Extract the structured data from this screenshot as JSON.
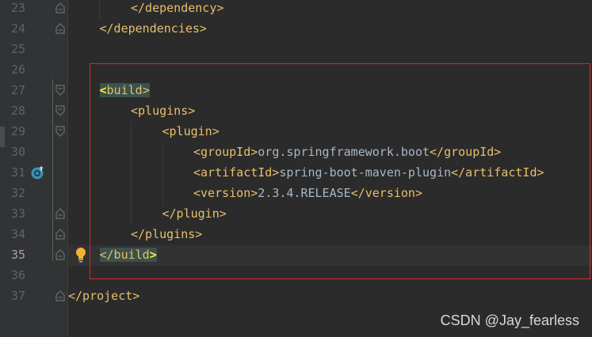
{
  "lines": [
    {
      "num": "23",
      "indent": 2,
      "segments": [
        {
          "t": "tag",
          "v": "</dependency>"
        }
      ],
      "fold": "end"
    },
    {
      "num": "24",
      "indent": 1,
      "segments": [
        {
          "t": "tag",
          "v": "</dependencies>"
        }
      ],
      "fold": "end"
    },
    {
      "num": "25",
      "indent": 0,
      "segments": []
    },
    {
      "num": "26",
      "indent": 0,
      "segments": []
    },
    {
      "num": "27",
      "indent": 1,
      "segments": [
        {
          "t": "brace",
          "v": "<"
        },
        {
          "t": "htag",
          "v": "build"
        },
        {
          "t": "htagend",
          "v": ">"
        }
      ],
      "fold": "start"
    },
    {
      "num": "28",
      "indent": 2,
      "segments": [
        {
          "t": "tag",
          "v": "<plugins>"
        }
      ],
      "fold": "start"
    },
    {
      "num": "29",
      "indent": 3,
      "segments": [
        {
          "t": "tag",
          "v": "<plugin>"
        }
      ],
      "fold": "start"
    },
    {
      "num": "30",
      "indent": 4,
      "segments": [
        {
          "t": "tag",
          "v": "<groupId>"
        },
        {
          "t": "txt",
          "v": "org.springframework.boot"
        },
        {
          "t": "tag",
          "v": "</groupId>"
        }
      ]
    },
    {
      "num": "31",
      "indent": 4,
      "segments": [
        {
          "t": "tag",
          "v": "<artifactId>"
        },
        {
          "t": "txt",
          "v": "spring-boot-maven-plugin"
        },
        {
          "t": "tag",
          "v": "</artifactId>"
        }
      ]
    },
    {
      "num": "32",
      "indent": 4,
      "segments": [
        {
          "t": "tag",
          "v": "<version>"
        },
        {
          "t": "txt",
          "v": "2.3.4.RELEASE"
        },
        {
          "t": "tag",
          "v": "</version>"
        }
      ]
    },
    {
      "num": "33",
      "indent": 3,
      "segments": [
        {
          "t": "tag",
          "v": "</plugin>"
        }
      ],
      "fold": "end"
    },
    {
      "num": "34",
      "indent": 2,
      "segments": [
        {
          "t": "tag",
          "v": "</plugins>"
        }
      ],
      "fold": "end"
    },
    {
      "num": "35",
      "indent": 1,
      "segments": [
        {
          "t": "htagclose",
          "v": "</build"
        },
        {
          "t": "brace",
          "v": ">"
        }
      ],
      "fold": "end",
      "current": true
    },
    {
      "num": "36",
      "indent": 0,
      "segments": []
    },
    {
      "num": "37",
      "indent": 0,
      "segments": [
        {
          "t": "tag",
          "v": "</project>"
        }
      ],
      "fold": "end"
    }
  ],
  "watermark": "CSDN @Jay_fearless",
  "colors": {
    "background": "#2b2b2b",
    "gutter": "#313335",
    "tag": "#e8bf6a",
    "text": "#a9b7c6",
    "match_highlight": "#3b514d",
    "selection_box": "#d12b2b"
  },
  "icons": {
    "gutter_line_31": "spring-run-icon",
    "intention_line_35": "lightbulb-icon"
  }
}
